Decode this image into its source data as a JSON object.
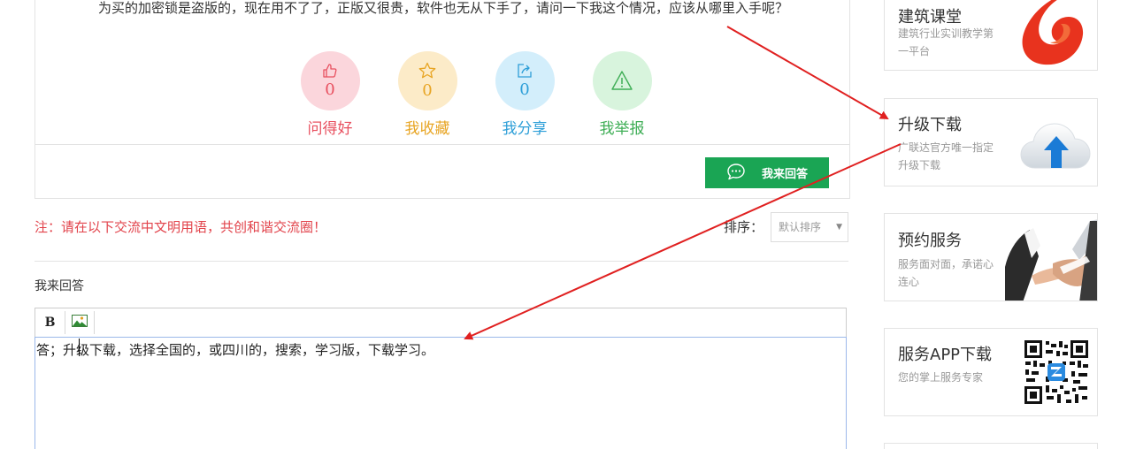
{
  "question": {
    "text": "为买的加密锁是盗版的，现在用不了了，正版又很贵，软件也无从下手了，请问一下我这个情况，应该从哪里入手呢？"
  },
  "actions": [
    {
      "count": "0",
      "label": "问得好",
      "icon": "thumbs-up-icon",
      "color": "#e8505f"
    },
    {
      "count": "0",
      "label": "我收藏",
      "icon": "star-icon",
      "color": "#e8a524"
    },
    {
      "count": "0",
      "label": "我分享",
      "icon": "share-icon",
      "color": "#2e9fd8"
    },
    {
      "count": "",
      "label": "我举报",
      "icon": "warning-icon",
      "color": "#3fae56"
    }
  ],
  "answer_button": {
    "label": "我来回答",
    "icon": "chat-bubble-icon",
    "color": "#1aa554"
  },
  "notice": "注：请在以下交流中文明用语，共创和谐交流圈！",
  "sort": {
    "label": "排序：",
    "selected": "默认排序"
  },
  "my_answer": {
    "title": "我来回答",
    "toolbar": {
      "bold_label": "B",
      "image_icon": "image-icon"
    },
    "content": "答；升级下载，选择全国的，或四川的，搜索，学习版，下载学习。"
  },
  "sidebar": [
    {
      "title": "建筑课堂",
      "desc": "建筑行业实训教学第一平台",
      "icon": "course-logo-icon"
    },
    {
      "title": "升级下载",
      "desc": "广联达官方唯一指定升级下载",
      "icon": "cloud-upload-icon"
    },
    {
      "title": "预约服务",
      "desc": "服务面对面，承诺心连心",
      "icon": "handshake-image"
    },
    {
      "title": "服务APP下载",
      "desc": "您的掌上服务专家",
      "icon": "qr-code-icon"
    }
  ],
  "annotation_color": "#e02020"
}
